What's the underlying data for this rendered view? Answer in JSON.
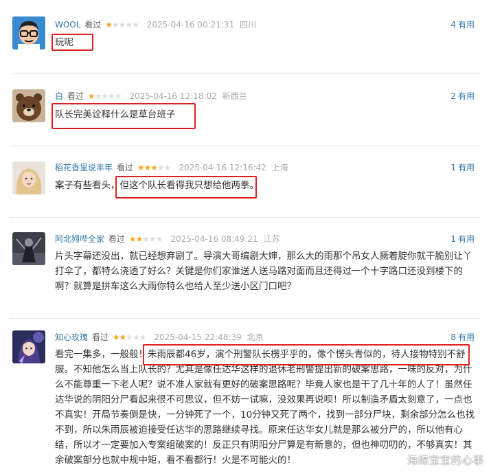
{
  "comments": [
    {
      "user": "WOOL",
      "verb": "看过",
      "rating": 1,
      "time": "2025-04-16 00:21:31",
      "location": "四川",
      "votes": "4",
      "votes_label": "有用",
      "text": "玩呢",
      "avatar_icon": "glasses-man-cartoon-avatar"
    },
    {
      "user": "白",
      "verb": "看过",
      "rating": 1,
      "time": "2025-04-16 12:18:02",
      "location": "新西兰",
      "votes": "2",
      "votes_label": "有用",
      "text": "队长完美诠释什么是草台班子",
      "avatar_icon": "brown-bear-avatar"
    },
    {
      "user": "稻花香里说丰年",
      "verb": "看过",
      "rating": 3,
      "time": "2025-04-16 12:16:42",
      "location": "上海",
      "votes": "1",
      "votes_label": "有用",
      "text": "案子有些看头，但这个队长看得我只想给他两拳。",
      "avatar_icon": "blonde-girl-avatar"
    },
    {
      "user": "阿北翙哔全家",
      "verb": "看过",
      "rating": 2,
      "time": "2025-04-16 08:49:21",
      "location": "江苏",
      "votes": "1",
      "votes_label": "有用",
      "text": "片头字幕还没出，就已经想弃剧了。导演大哥编剧大婶，那么大的雨那个吊女人撅着腚你就干脆别让丫打伞了，都特么浇透了好么？关键是你们家谁送人送马路对面而且还得过一个十字路口还没到楼下的啊？就算是拼车这么大雨你特么也给人至少送小区门口吧？",
      "avatar_icon": "dark-figure-avatar"
    },
    {
      "user": "知心玫瑰",
      "verb": "看过",
      "rating": 2,
      "time": "2025-04-15 22:48:39",
      "location": "北京",
      "votes": "8",
      "votes_label": "有用",
      "text": "看完一集多，一般般！朱雨辰都46岁，演个刑警队长楞乎乎的，像个愣头青似的，待人接物特别不舒服。不知他怎么当上队长的？尤其是像任达华这样的退休老刑警提出新的破案思路，一味的反对，为什么不能尊重一下老人呢？说不准人家就有更好的破案思路呢？毕竟人家也是干了几十年的人了！虽然任达华说的阴阳分尸看起来很不可思议，但不妨一试嘛，没效果再说呗！所以制造矛盾太刻意了，一点也不真实！开局节奏倒是快，一分钟死了一个，10分钟又死了两个，找到一部分尸块，剩余部分怎么也找不到，所以朱雨辰被迫接受任达华的思路继续寻找。原来任达华女儿就是那么被分尸的，所以他有心结，所以才一定要加入专案组破案的！反正只有阴阳分尸算是有新意的，但也神叨叨的，不够真实！其余破案部分也就中规中矩，看不看都行！火是不可能火的！",
      "avatar_icon": "anime-warrior-avatar"
    }
  ],
  "watermark": "海绵宝宝的心事",
  "colors": {
    "username": "#3377aa",
    "star_on": "#f5a623",
    "star_off": "#dddddd",
    "highlight_box": "#e02020"
  }
}
